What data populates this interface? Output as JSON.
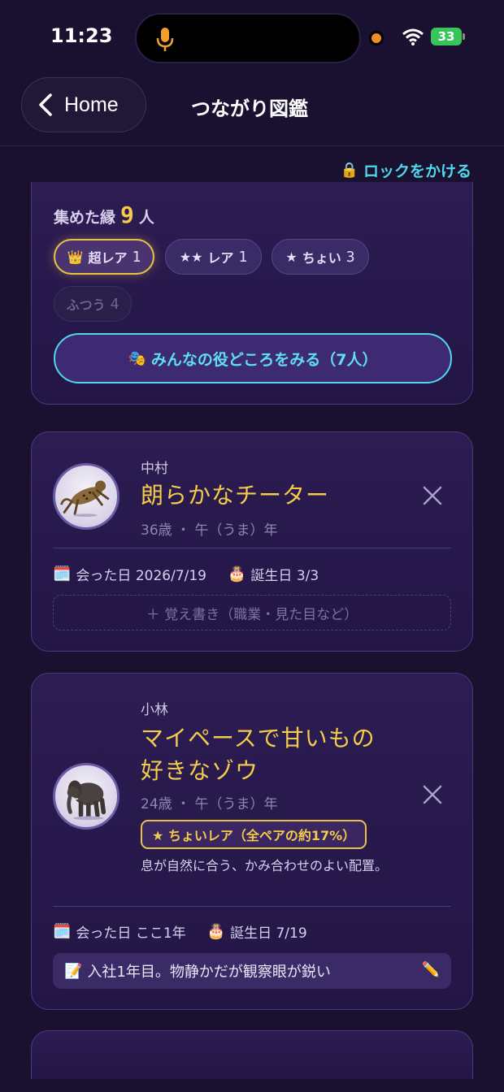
{
  "status_bar": {
    "time": "11:23",
    "battery": "33"
  },
  "header": {
    "back_label": "Home",
    "title": "つながり図鑑"
  },
  "lock_link": "ロックをかける",
  "summary": {
    "title_prefix": "集めた縁",
    "count": "9",
    "title_suffix": "人",
    "chips": [
      {
        "icon": "👑",
        "label": "超レア",
        "count": "1"
      },
      {
        "icon": "★★",
        "label": "レア",
        "count": "1"
      },
      {
        "icon": "★",
        "label": "ちょい",
        "count": "3"
      },
      {
        "icon": "",
        "label": "ふつう",
        "count": "4"
      }
    ],
    "view_roles_button": "みんなの役どころをみる（7人）"
  },
  "people": [
    {
      "name": "中村",
      "title": "朗らかなチーター",
      "meta": "36歳 ・ 午（うま）年",
      "met_label": "会った日 2026/7/19",
      "birthday_label": "誕生日 3/3",
      "memo_placeholder": "＋ 覚え書き（職業・見た目など）",
      "avatar_icon": "cheetah"
    },
    {
      "name": "小林",
      "title_line1": "マイペースで甘いもの",
      "title_line2": "好きなゾウ",
      "meta": "24歳 ・ 午（うま）年",
      "rarity_badge": "★ ちょいレア（全ペアの約17%）",
      "description": "息が自然に合う、かみ合わせのよい配置。",
      "met_label": "会った日 ここ1年",
      "birthday_label": "誕生日 7/19",
      "memo": "入社1年目。物静かだが観察眼が鋭い",
      "avatar_icon": "elephant"
    }
  ],
  "colors": {
    "accent_gold": "#f3cc4c",
    "accent_cyan": "#4fd8ea",
    "background": "#1a1030",
    "card": "#2c1c52"
  }
}
